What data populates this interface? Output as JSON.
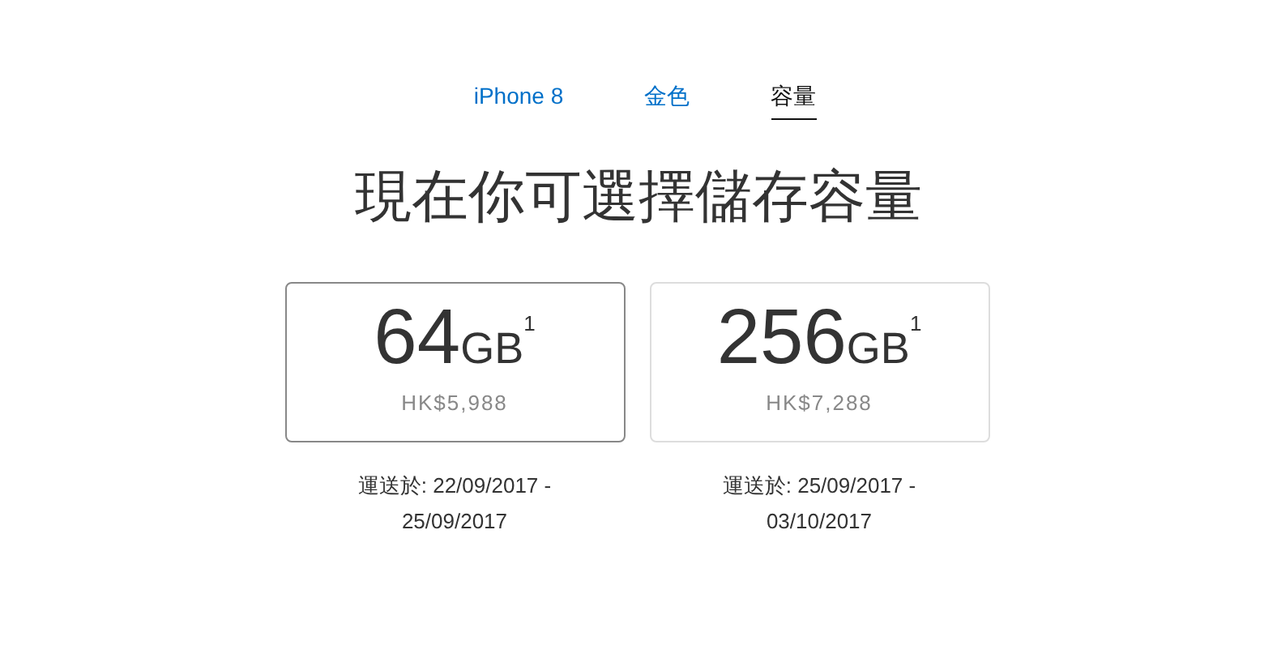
{
  "steps": [
    {
      "label": "iPhone 8",
      "selected": false
    },
    {
      "label": "金色",
      "selected": false
    },
    {
      "label": "容量",
      "selected": true
    }
  ],
  "heading": "現在你可選擇儲存容量",
  "options": [
    {
      "size": "64",
      "unit": "GB",
      "note": "1",
      "price": "HK$5,988",
      "delivery": "運送於: 22/09/2017 - 25/09/2017",
      "selected": true
    },
    {
      "size": "256",
      "unit": "GB",
      "note": "1",
      "price": "HK$7,288",
      "delivery": "運送於: 25/09/2017 - 03/10/2017",
      "selected": false
    }
  ]
}
